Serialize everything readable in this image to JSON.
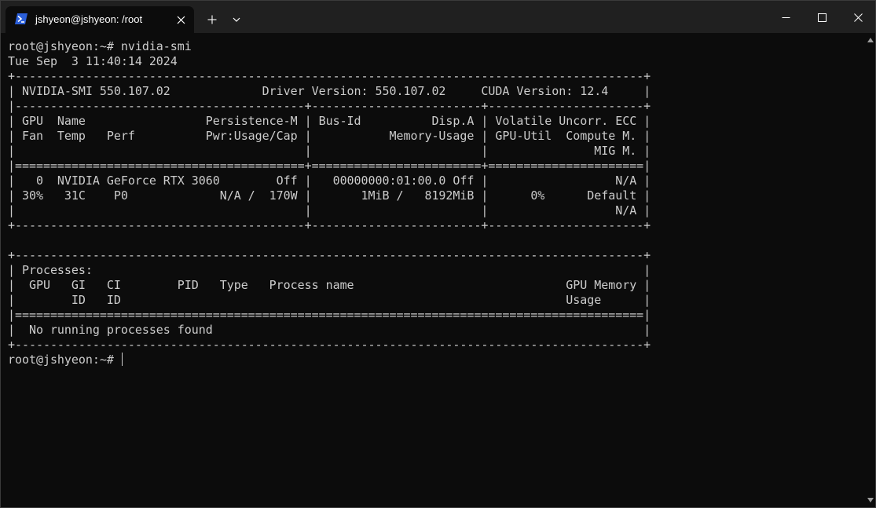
{
  "window": {
    "tab_title": "jshyeon@jshyeon: /root"
  },
  "icons": {
    "tab_icon": "powershell-icon",
    "tab_close": "close-icon",
    "new_tab": "plus-icon",
    "dropdown": "chevron-down-icon",
    "minimize": "minimize-icon",
    "maximize": "maximize-icon",
    "close": "close-icon",
    "scroll_up": "scroll-up-arrow-icon",
    "scroll_down": "scroll-down-arrow-icon"
  },
  "colors": {
    "terminal_bg": "#0c0c0c",
    "terminal_fg": "#cccccc",
    "titlebar_bg": "#202020"
  },
  "terminal": {
    "lines": [
      "root@jshyeon:~# nvidia-smi",
      "Tue Sep  3 11:40:14 2024",
      "+-----------------------------------------------------------------------------------------+",
      "| NVIDIA-SMI 550.107.02             Driver Version: 550.107.02     CUDA Version: 12.4     |",
      "|-----------------------------------------+------------------------+----------------------+",
      "| GPU  Name                 Persistence-M | Bus-Id          Disp.A | Volatile Uncorr. ECC |",
      "| Fan  Temp   Perf          Pwr:Usage/Cap |           Memory-Usage | GPU-Util  Compute M. |",
      "|                                         |                        |               MIG M. |",
      "|=========================================+========================+======================|",
      "|   0  NVIDIA GeForce RTX 3060        Off |   00000000:01:00.0 Off |                  N/A |",
      "| 30%   31C    P0             N/A /  170W |       1MiB /   8192MiB |      0%      Default |",
      "|                                         |                        |                  N/A |",
      "+-----------------------------------------+------------------------+----------------------+",
      "",
      "+-----------------------------------------------------------------------------------------+",
      "| Processes:                                                                              |",
      "|  GPU   GI   CI        PID   Type   Process name                              GPU Memory |",
      "|        ID   ID                                                               Usage      |",
      "|=========================================================================================|",
      "|  No running processes found                                                             |",
      "+-----------------------------------------------------------------------------------------+"
    ],
    "prompt": "root@jshyeon:~# "
  }
}
